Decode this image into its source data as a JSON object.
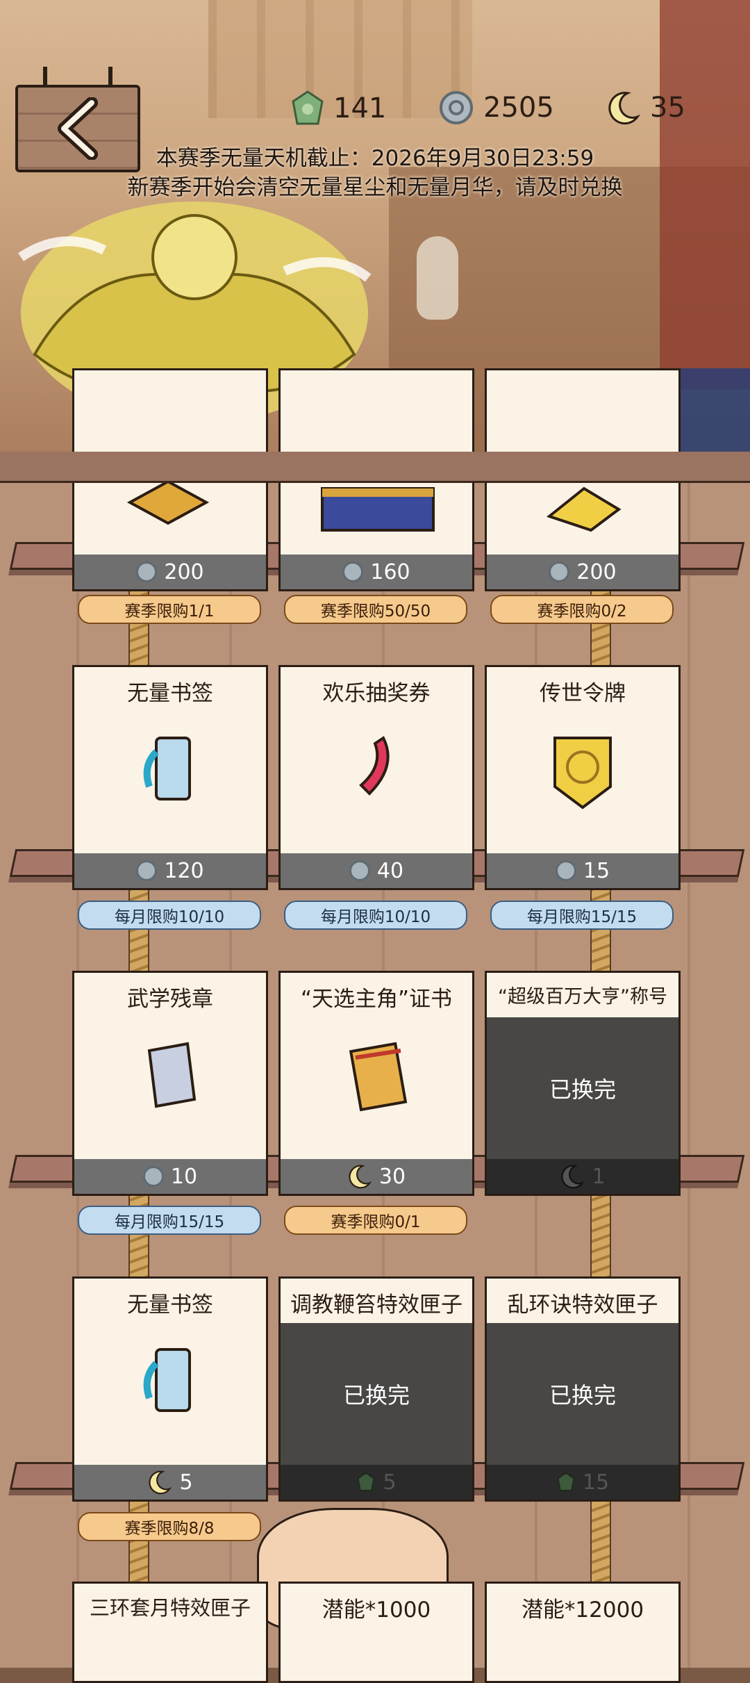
{
  "header": {
    "currencies": [
      {
        "icon": "jade-icon",
        "value": "141"
      },
      {
        "icon": "silver-coin-icon",
        "value": "2505"
      },
      {
        "icon": "moon-icon",
        "value": "35"
      }
    ],
    "notice_line1": "本赛季无量天机截止：2026年9月30日23:59",
    "notice_line2": "新赛季开始会清空无量星尘和无量月华，请及时兑换"
  },
  "rows": [
    {
      "items": [
        {
          "name": "",
          "price": "200",
          "currency": "coin",
          "sold_out": false
        },
        {
          "name": "",
          "price": "160",
          "currency": "coin",
          "sold_out": false
        },
        {
          "name": "",
          "price": "200",
          "currency": "coin",
          "sold_out": false
        }
      ],
      "limits": [
        {
          "text": "赛季限购1/1",
          "type": "season"
        },
        {
          "text": "赛季限购50/50",
          "type": "season"
        },
        {
          "text": "赛季限购0/2",
          "type": "season"
        }
      ]
    },
    {
      "items": [
        {
          "name": "无量书签",
          "price": "120",
          "currency": "coin",
          "sold_out": false
        },
        {
          "name": "欢乐抽奖券",
          "price": "40",
          "currency": "coin",
          "sold_out": false
        },
        {
          "name": "传世令牌",
          "price": "15",
          "currency": "coin",
          "sold_out": false
        }
      ],
      "limits": [
        {
          "text": "每月限购10/10",
          "type": "month"
        },
        {
          "text": "每月限购10/10",
          "type": "month"
        },
        {
          "text": "每月限购15/15",
          "type": "month"
        }
      ]
    },
    {
      "items": [
        {
          "name": "武学残章",
          "price": "10",
          "currency": "coin",
          "sold_out": false
        },
        {
          "name": "“天选主角”证书",
          "price": "30",
          "currency": "moon",
          "sold_out": false
        },
        {
          "name": "“超级百万大亨”称号",
          "price": "1",
          "currency": "moon",
          "sold_out": true
        }
      ],
      "limits": [
        {
          "text": "每月限购15/15",
          "type": "month"
        },
        {
          "text": "赛季限购0/1",
          "type": "season"
        }
      ]
    },
    {
      "items": [
        {
          "name": "无量书签",
          "price": "5",
          "currency": "moon",
          "sold_out": false
        },
        {
          "name": "调教鞭笞特效匣子",
          "price": "5",
          "currency": "jade",
          "sold_out": true
        },
        {
          "name": "乱环诀特效匣子",
          "price": "15",
          "currency": "jade",
          "sold_out": true
        }
      ],
      "limits": [
        {
          "text": "赛季限购8/8",
          "type": "season"
        }
      ]
    },
    {
      "items": [
        {
          "name": "三环套月特效匣子"
        },
        {
          "name": "潜能*1000"
        },
        {
          "name": "潜能*12000"
        }
      ]
    }
  ],
  "sold_out_label": "已换完"
}
